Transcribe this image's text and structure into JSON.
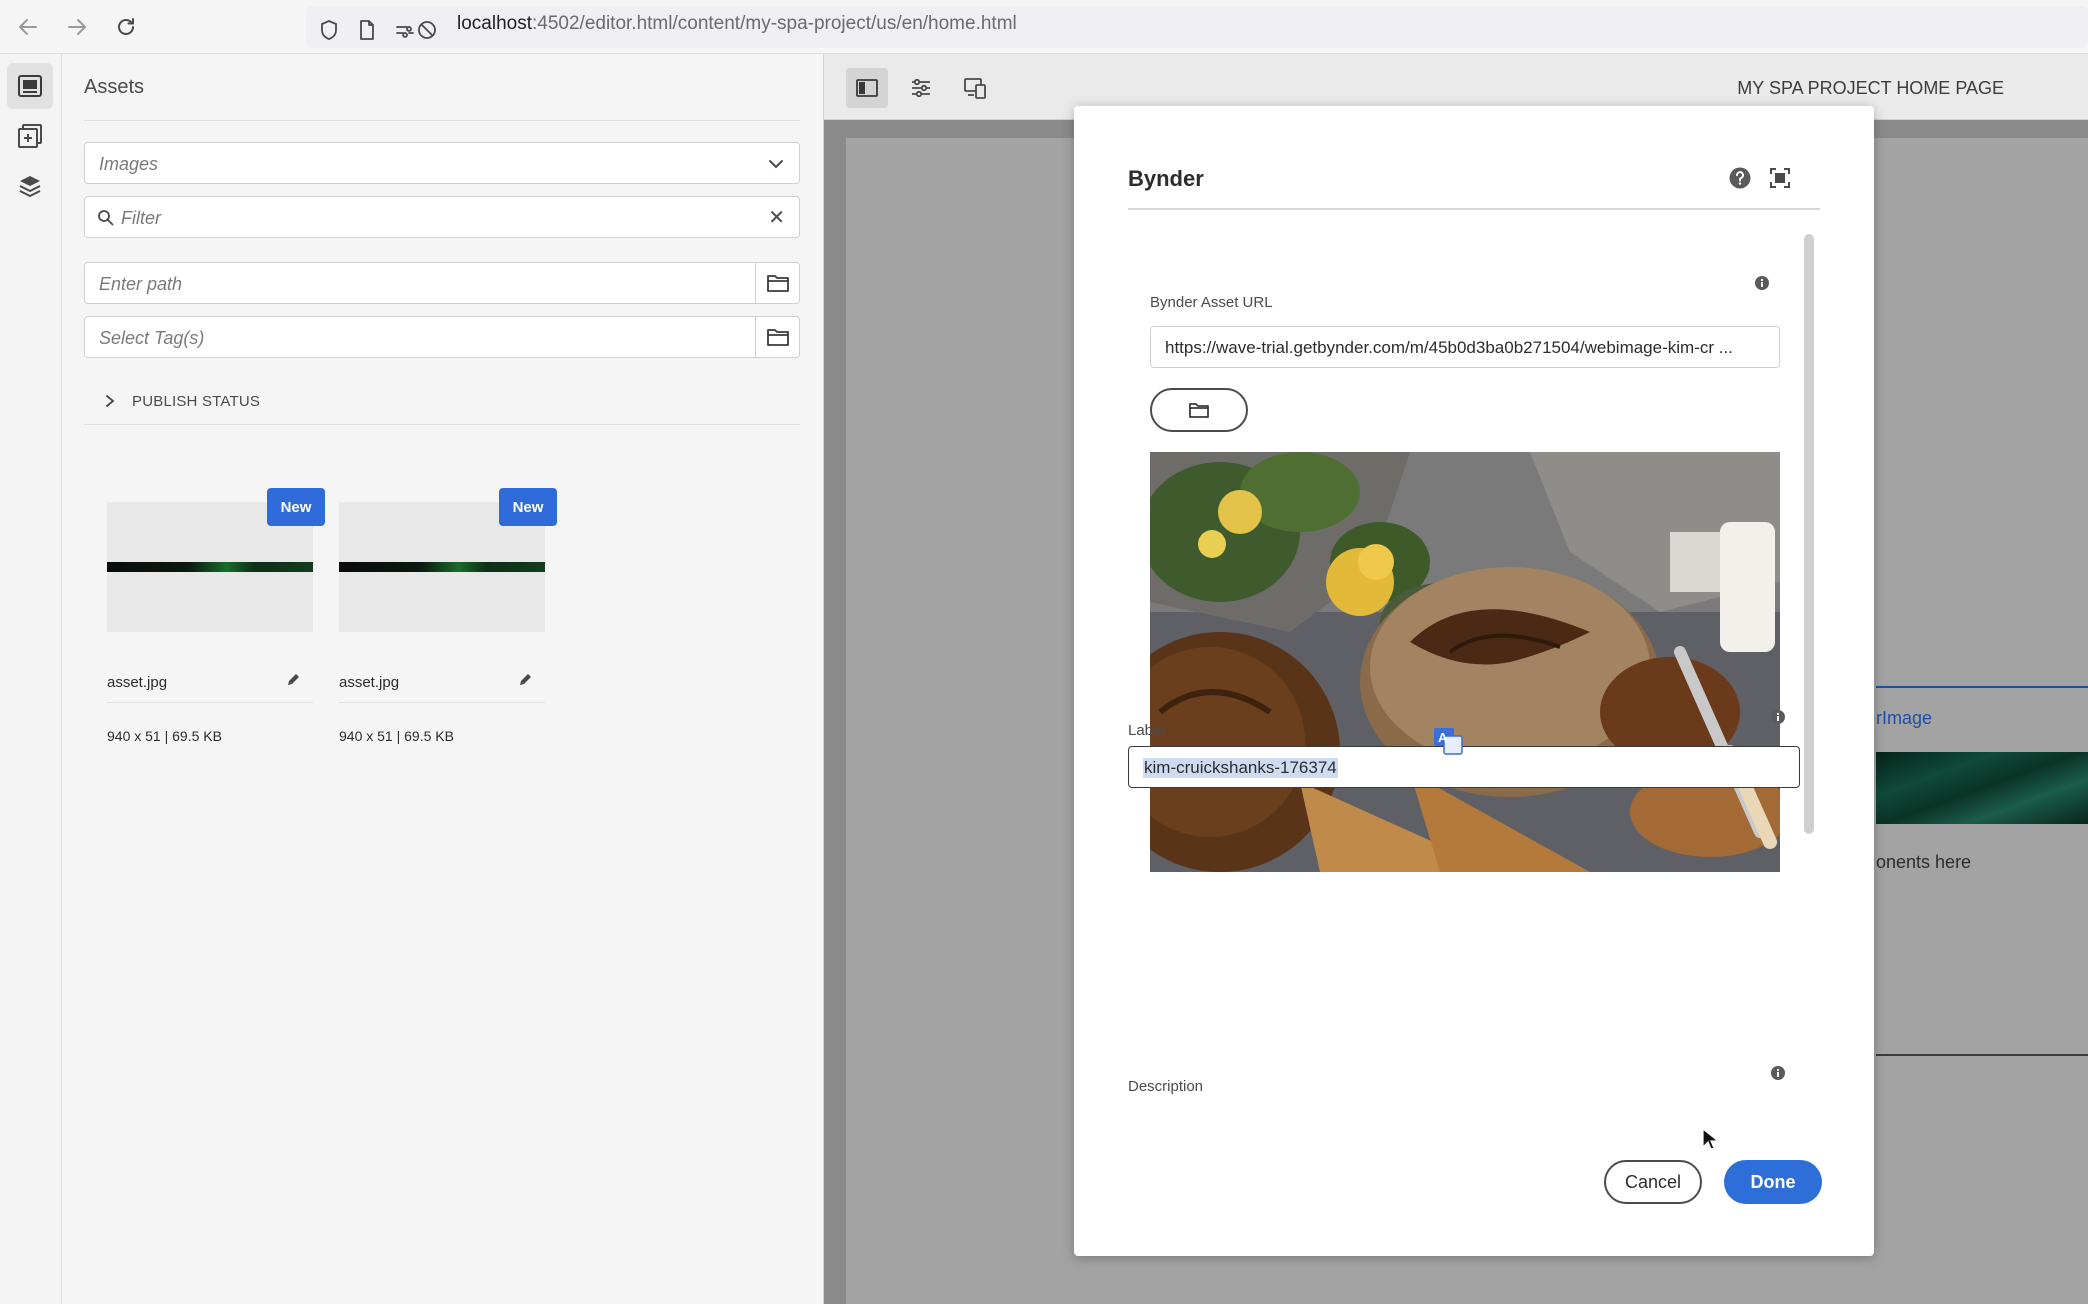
{
  "browser": {
    "url_host": "localhost",
    "url_path": ":4502/editor.html/content/my-spa-project/us/en/home.html"
  },
  "assets": {
    "title": "Assets",
    "type_select": {
      "value": "Images"
    },
    "filter": {
      "placeholder": "Filter"
    },
    "path": {
      "placeholder": "Enter path"
    },
    "tags": {
      "placeholder": "Select Tag(s)"
    },
    "publish_status_label": "PUBLISH STATUS",
    "cards": [
      {
        "badge": "New",
        "name": "asset.jpg",
        "meta": "940 x 51 | 69.5 KB"
      },
      {
        "badge": "New",
        "name": "asset.jpg",
        "meta": "940 x 51 | 69.5 KB"
      }
    ]
  },
  "editor": {
    "page_title": "MY SPA PROJECT HOME PAGE",
    "component_label": "rImage",
    "drag_hint": "onents here"
  },
  "dialog": {
    "title": "Bynder",
    "asset_url_label": "Bynder Asset URL",
    "asset_url_value": "https://wave-trial.getbynder.com/m/45b0d3ba0b271504/webimage-kim-cr  ...",
    "label_label": "Label",
    "label_value": "kim-cruickshanks-176374",
    "description_label": "Description",
    "cancel_label": "Cancel",
    "done_label": "Done"
  },
  "colors": {
    "accent": "#2d6ed8",
    "badge": "#2f6bd9",
    "component_blue": "#1d4ea8"
  },
  "icons": {
    "help": "help-icon",
    "fullscreen": "fullscreen-icon",
    "info": "info-icon",
    "folder": "folder-icon",
    "translate": "translate-icon"
  }
}
